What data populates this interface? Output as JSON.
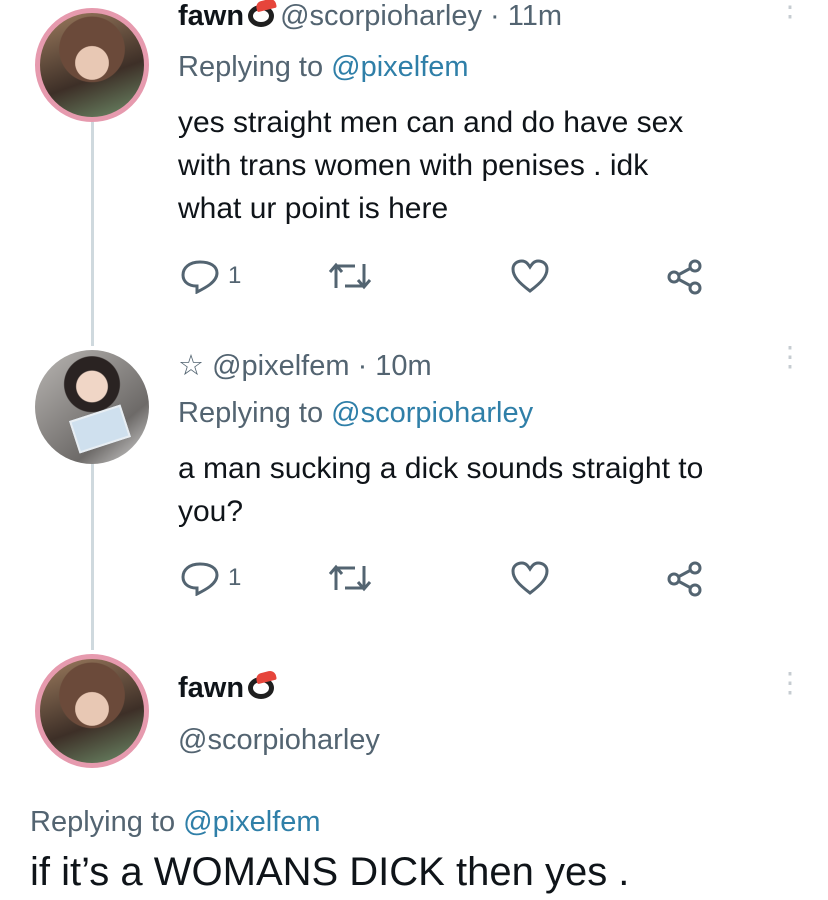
{
  "tweets": [
    {
      "name": "fawn",
      "handle": "@scorpioharley",
      "time": "· 11m",
      "replying_prefix": "Replying to",
      "replying_handle": "@pixelfem",
      "lines": [
        "yes straight men can and do have sex",
        "with trans women with penises . idk",
        "what ur point is here"
      ],
      "reply_count": "1",
      "avatar_icon": "profile-photo-fawn"
    },
    {
      "star": "☆",
      "handle": "@pixelfem",
      "time": "· 10m",
      "replying_prefix": "Replying to",
      "replying_handle": "@scorpioharley",
      "lines": [
        "a man sucking a dick sounds straight to",
        "you?"
      ],
      "reply_count": "1",
      "avatar_icon": "profile-photo-pixelfem"
    }
  ],
  "main_tweet": {
    "name": "fawn",
    "handle": "@scorpioharley",
    "replying_prefix": "Replying to",
    "replying_handle": "@pixelfem",
    "text": "if it’s a WOMANS DICK then yes ."
  },
  "more_glyph": "⋮",
  "colors": {
    "accent": "#2f7fa8",
    "muted": "#536471",
    "thread_line": "#cfd9de",
    "avatar_ring": "#e69aae"
  },
  "icons": [
    "sushi-emoji-icon",
    "reply-icon",
    "retweet-icon",
    "like-icon",
    "share-icon",
    "more-icon",
    "star-icon"
  ]
}
